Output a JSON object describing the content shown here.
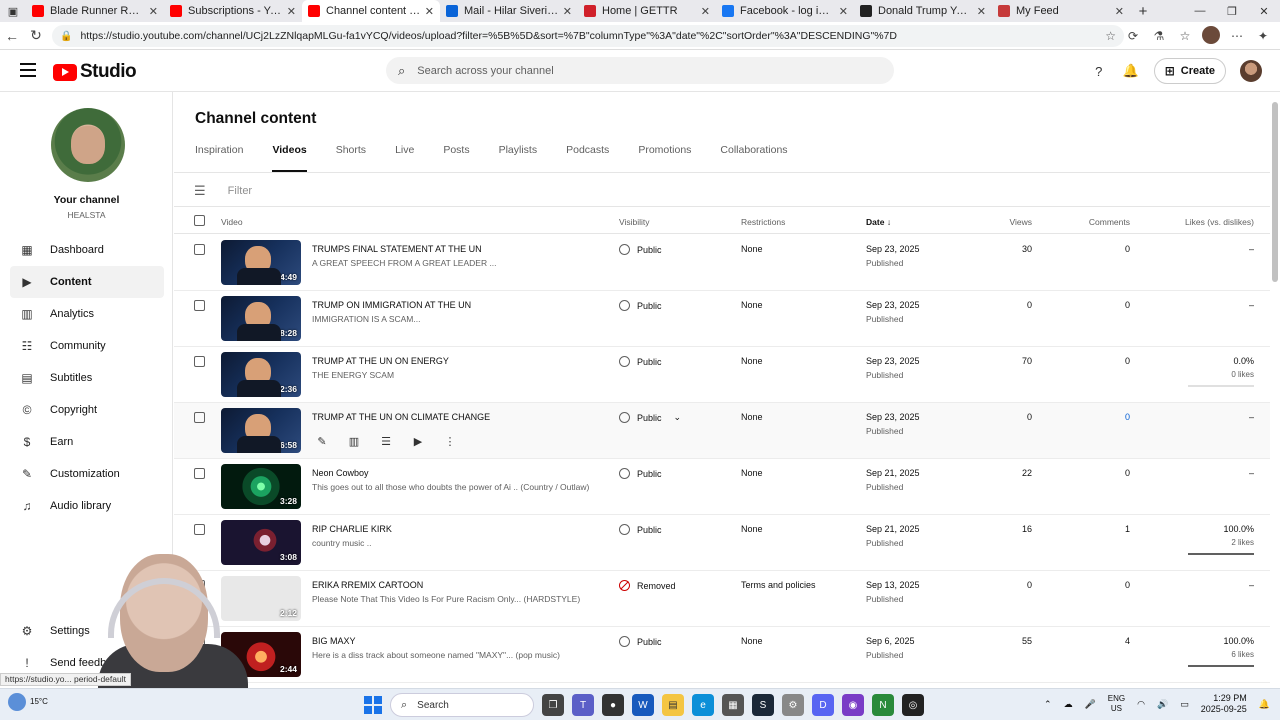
{
  "browser": {
    "tabs": [
      {
        "title": "Blade Runner Radio - YouTube",
        "color": "#ff0000"
      },
      {
        "title": "Subscriptions - YouTube",
        "color": "#ff0000"
      },
      {
        "title": "Channel content - YouTube",
        "color": "#ff0000",
        "active": true
      },
      {
        "title": "Mail - Hilar Siveri - Outlook",
        "color": "#0a64d8"
      },
      {
        "title": "Home | GETTR",
        "color": "#d0202a"
      },
      {
        "title": "Facebook - log in or sign up",
        "color": "#1877f2"
      },
      {
        "title": "Donald Trump Yelling at the",
        "color": "#222222"
      },
      {
        "title": "My Feed",
        "color": "#c63a3a"
      }
    ],
    "url": "https://studio.youtube.com/channel/UCj2LzZNlqapMLGu-fa1vYCQ/videos/upload?filter=%5B%5D&sort=%7B\"columnType\"%3A\"date\"%2C\"sortOrder\"%3A\"DESCENDING\"%7D",
    "status_url": "https://studio.yo...                                    period-default"
  },
  "header": {
    "logo": "Studio",
    "search_placeholder": "Search across your channel",
    "create_label": "Create"
  },
  "sidebar": {
    "channel_name": "Your channel",
    "channel_handle": "HEALSTA",
    "items": [
      {
        "label": "Dashboard",
        "icon": "dashboard-icon",
        "glyph": "▦"
      },
      {
        "label": "Content",
        "icon": "content-icon",
        "glyph": "▶",
        "active": true
      },
      {
        "label": "Analytics",
        "icon": "analytics-icon",
        "glyph": "▥"
      },
      {
        "label": "Community",
        "icon": "community-icon",
        "glyph": "☷"
      },
      {
        "label": "Subtitles",
        "icon": "subtitles-icon",
        "glyph": "▤"
      },
      {
        "label": "Copyright",
        "icon": "copyright-icon",
        "glyph": "©"
      },
      {
        "label": "Earn",
        "icon": "earn-icon",
        "glyph": "$"
      },
      {
        "label": "Customization",
        "icon": "customization-icon",
        "glyph": "✎"
      },
      {
        "label": "Audio library",
        "icon": "audio-library-icon",
        "glyph": "♫"
      }
    ],
    "bottom": [
      {
        "label": "Settings",
        "icon": "settings-icon",
        "glyph": "⚙"
      },
      {
        "label": "Send feedback",
        "icon": "feedback-icon",
        "glyph": "!"
      }
    ]
  },
  "main": {
    "title": "Channel content",
    "tabs": [
      "Inspiration",
      "Videos",
      "Shorts",
      "Live",
      "Posts",
      "Playlists",
      "Podcasts",
      "Promotions",
      "Collaborations"
    ],
    "active_tab": "Videos",
    "filter_placeholder": "Filter",
    "columns": {
      "video": "Video",
      "visibility": "Visibility",
      "restrictions": "Restrictions",
      "date": "Date",
      "views": "Views",
      "comments": "Comments",
      "likes": "Likes (vs. dislikes)"
    },
    "rows": [
      {
        "title": "TRUMPS FINAL STATEMENT AT THE UN",
        "desc": "A GREAT SPEECH FROM A GREAT LEADER ...",
        "duration": "4:49",
        "thumb": "trump",
        "visibility": "Public",
        "restrictions": "None",
        "date": "Sep 23, 2025",
        "status": "Published",
        "views": "30",
        "comments": "0",
        "likes": "–",
        "likes_sub": ""
      },
      {
        "title": "TRUMP ON IMMIGRATION AT THE UN",
        "desc": "IMMIGRATION IS A SCAM...",
        "duration": "8:28",
        "thumb": "trump",
        "visibility": "Public",
        "restrictions": "None",
        "date": "Sep 23, 2025",
        "status": "Published",
        "views": "0",
        "comments": "0",
        "likes": "–",
        "likes_sub": ""
      },
      {
        "title": "TRUMP AT THE UN ON ENERGY",
        "desc": "THE ENERGY SCAM",
        "duration": "2:36",
        "thumb": "trump",
        "visibility": "Public",
        "restrictions": "None",
        "date": "Sep 23, 2025",
        "status": "Published",
        "views": "70",
        "comments": "0",
        "likes": "0.0%",
        "likes_sub": "0 likes",
        "likebar": 0
      },
      {
        "title": "TRUMP AT THE UN ON CLIMATE CHANGE",
        "desc": "",
        "duration": "6:58",
        "thumb": "trump",
        "visibility": "Public",
        "restrictions": "None",
        "date": "Sep 23, 2025",
        "status": "Published",
        "views": "0",
        "comments": "0",
        "likes": "–",
        "likes_sub": "",
        "hover": true
      },
      {
        "title": "Neon Cowboy",
        "desc": "This goes out to all those who doubts the power of Ai .. (Country / Outlaw)",
        "duration": "3:28",
        "thumb": "neon",
        "visibility": "Public",
        "restrictions": "None",
        "date": "Sep 21, 2025",
        "status": "Published",
        "views": "22",
        "comments": "0",
        "likes": "–",
        "likes_sub": ""
      },
      {
        "title": "RIP CHARLIE KIRK",
        "desc": "country music ..",
        "duration": "3:08",
        "thumb": "rip",
        "visibility": "Public",
        "restrictions": "None",
        "date": "Sep 21, 2025",
        "status": "Published",
        "views": "16",
        "comments": "1",
        "likes": "100.0%",
        "likes_sub": "2 likes",
        "likebar": 1
      },
      {
        "title": "ERIKA RREMIX CARTOON",
        "desc": "Please Note That This Video Is For Pure Racism Only... (HARDSTYLE)",
        "duration": "2:12",
        "thumb": "erika",
        "visibility": "Removed",
        "restrictions": "Terms and policies",
        "date": "Sep 13, 2025",
        "status": "Published",
        "views": "0",
        "comments": "0",
        "likes": "–",
        "likes_sub": ""
      },
      {
        "title": "BIG MAXY",
        "desc": "Here is a diss track about someone named \"MAXY\"... (pop music)",
        "duration": "2:44",
        "thumb": "maxy",
        "visibility": "Public",
        "restrictions": "None",
        "date": "Sep 6, 2025",
        "status": "Published",
        "views": "55",
        "comments": "4",
        "likes": "100.0%",
        "likes_sub": "6 likes",
        "likebar": 1
      }
    ]
  },
  "taskbar": {
    "weather": "15°C",
    "search_label": "Search",
    "lang_1": "ENG",
    "lang_2": "US",
    "time": "1:29 PM",
    "date": "2025-09-25",
    "notif_count": "3"
  }
}
